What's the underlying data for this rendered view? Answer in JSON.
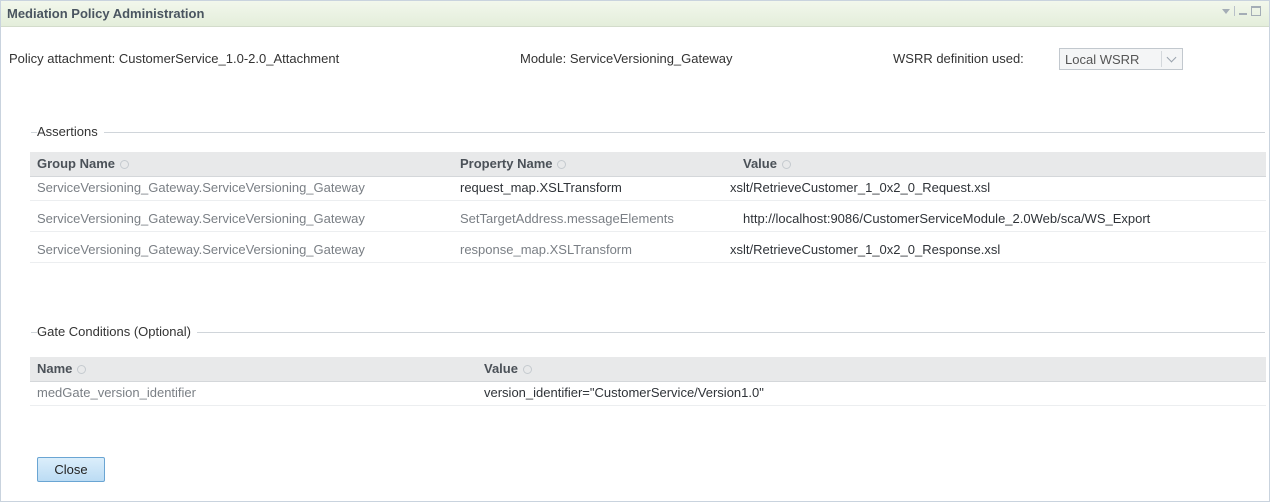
{
  "window": {
    "title": "Mediation Policy Administration"
  },
  "info": {
    "policy_attachment": "Policy attachment: CustomerService_1.0-2.0_Attachment",
    "module": "Module: ServiceVersioning_Gateway",
    "wsrr_label": "WSRR definition used:",
    "wsrr_value": "Local WSRR"
  },
  "assertions": {
    "title": "Assertions",
    "columns": [
      "Group Name",
      "Property Name",
      "Value"
    ],
    "rows": [
      [
        "ServiceVersioning_Gateway.ServiceVersioning_Gateway",
        "request_map.XSLTransform",
        "xslt/RetrieveCustomer_1_0x2_0_Request.xsl"
      ],
      [
        "ServiceVersioning_Gateway.ServiceVersioning_Gateway",
        "SetTargetAddress.messageElements",
        "http://localhost:9086/CustomerServiceModule_2.0Web/sca/WS_Export"
      ],
      [
        "ServiceVersioning_Gateway.ServiceVersioning_Gateway",
        "response_map.XSLTransform",
        "xslt/RetrieveCustomer_1_0x2_0_Response.xsl"
      ]
    ]
  },
  "gate_conditions": {
    "title": "Gate Conditions (Optional)",
    "columns": [
      "Name",
      "Value"
    ],
    "rows": [
      [
        "medGate_version_identifier",
        "version_identifier=\"CustomerService/Version1.0\""
      ]
    ]
  },
  "buttons": {
    "close": "Close"
  },
  "icons": {
    "window_menu": "chevron-down-icon",
    "minimize": "minimize-icon",
    "maximize": "maximize-icon",
    "sort": "sort-icon"
  },
  "colors": {
    "titlebar": "#e8f0e0",
    "header_row": "#e8e9ea",
    "button": "#c8e2f6"
  }
}
